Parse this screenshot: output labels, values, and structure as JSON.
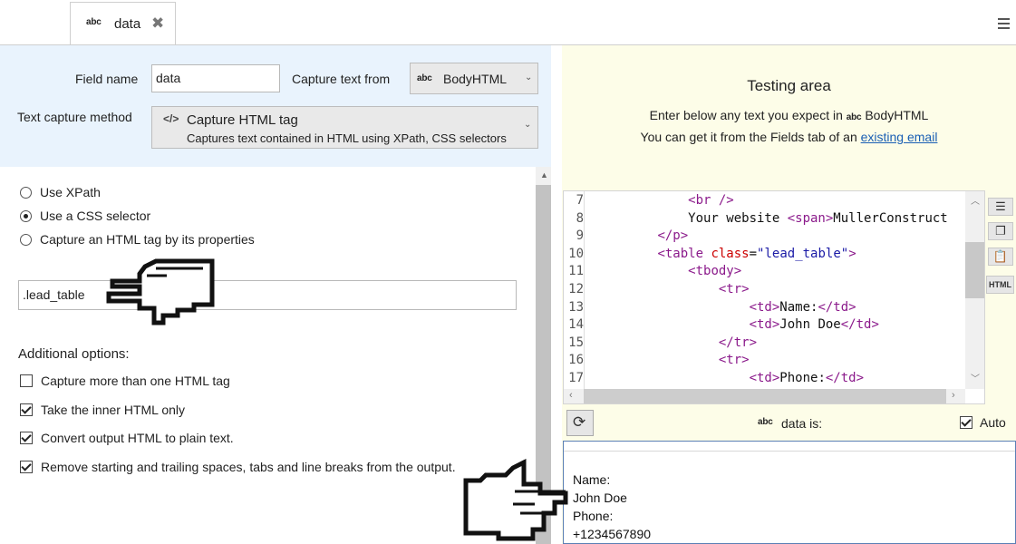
{
  "tab": {
    "badge": "abc",
    "label": "data"
  },
  "left": {
    "field_name_label": "Field name",
    "field_name_value": "data",
    "capture_from_label": "Capture text from",
    "capture_from_badge": "abc",
    "capture_from_value": "BodyHTML",
    "method_label": "Text capture method",
    "method_title": "Capture HTML tag",
    "method_desc": "Captures text contained in HTML using XPath, CSS selectors",
    "radios": [
      "Use XPath",
      "Use a CSS selector",
      "Capture an HTML tag by its properties"
    ],
    "selected_radio": 1,
    "selector_value": ".lead_table",
    "additional_label": "Additional options:",
    "options": [
      {
        "label": "Capture more than one HTML tag",
        "checked": false
      },
      {
        "label": "Take the inner HTML only",
        "checked": true
      },
      {
        "label": "Convert output HTML to plain text.",
        "checked": true
      },
      {
        "label": "Remove starting and trailing spaces, tabs and line breaks from the output.",
        "checked": true
      }
    ]
  },
  "right": {
    "title": "Testing area",
    "line1_prefix": "Enter below any text you expect in",
    "line1_badge": "abc",
    "line1_field": "BodyHTML",
    "line2_prefix": "You can get it from the Fields tab of an",
    "line2_link": "existing email",
    "editor_lines": [
      {
        "n": "7",
        "html": "            <span class=\"tag\">&lt;br /&gt;</span>"
      },
      {
        "n": "8",
        "html": "            Your website <span class=\"tag\">&lt;span&gt;</span>MullerConstruct"
      },
      {
        "n": "9",
        "html": "        <span class=\"tag\">&lt;/p&gt;</span>"
      },
      {
        "n": "10",
        "html": "        <span class=\"tag\">&lt;table</span> <span class=\"att\">class</span>=<span class=\"val\">\"lead_table\"</span><span class=\"tag\">&gt;</span>"
      },
      {
        "n": "11",
        "html": "            <span class=\"tag\">&lt;tbody&gt;</span>"
      },
      {
        "n": "12",
        "html": "                <span class=\"tag\">&lt;tr&gt;</span>"
      },
      {
        "n": "13",
        "html": "                    <span class=\"tag\">&lt;td&gt;</span>Name:<span class=\"tag\">&lt;/td&gt;</span>"
      },
      {
        "n": "14",
        "html": "                    <span class=\"tag\">&lt;td&gt;</span>John Doe<span class=\"tag\">&lt;/td&gt;</span>"
      },
      {
        "n": "15",
        "html": "                <span class=\"tag\">&lt;/tr&gt;</span>"
      },
      {
        "n": "16",
        "html": "                <span class=\"tag\">&lt;tr&gt;</span>"
      },
      {
        "n": "17",
        "html": "                    <span class=\"tag\">&lt;td&gt;</span>Phone:<span class=\"tag\">&lt;/td&gt;</span>"
      }
    ],
    "html_button": "HTML",
    "result_badge": "abc",
    "result_label": "data is:",
    "auto_label": "Auto",
    "auto_checked": true,
    "output_lines": [
      "Name:",
      "John Doe",
      "Phone:",
      "+1234567890"
    ]
  }
}
